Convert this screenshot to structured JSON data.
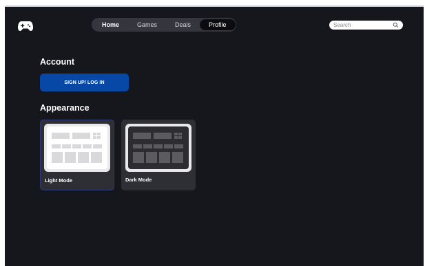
{
  "nav": {
    "tabs": [
      {
        "label": "Home"
      },
      {
        "label": "Games"
      },
      {
        "label": "Deals"
      },
      {
        "label": "Profile"
      }
    ],
    "active_tab": "Profile"
  },
  "search": {
    "placeholder": "Search",
    "icon": "search-icon"
  },
  "logo": {
    "icon": "gamepad-icon"
  },
  "account": {
    "title": "Account",
    "signup_label": "SIGN UP/ LOG IN"
  },
  "appearance": {
    "title": "Appearance",
    "options": [
      {
        "label": "Light Mode",
        "selected": true,
        "icon": "light-layout-preview-icon"
      },
      {
        "label": "Dark Mode",
        "selected": false,
        "icon": "dark-layout-preview-icon"
      }
    ]
  },
  "colors": {
    "background": "#16161d",
    "nav_bar": "#35363d",
    "active_tab": "#0b0b10",
    "primary_button": "#0747a6",
    "card": "#2e2e35",
    "selected_border": "#2e3a79"
  }
}
